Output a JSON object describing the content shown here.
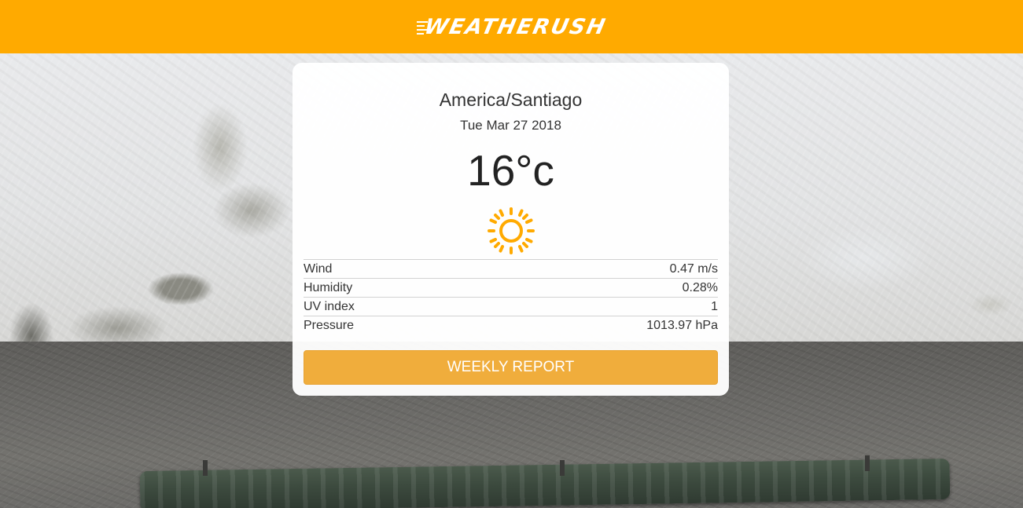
{
  "header": {
    "logo_text": "WEATHERUSH",
    "background_color": "#ffaa00"
  },
  "weather": {
    "city": "America/Santiago",
    "date": "Tue Mar 27 2018",
    "temperature": "16°c",
    "condition_icon": "sun-icon",
    "icon_color": "#ffaa00"
  },
  "stats": [
    {
      "label": "Wind",
      "value": "0.47 m/s"
    },
    {
      "label": "Humidity",
      "value": "0.28%"
    },
    {
      "label": "UV index",
      "value": "1"
    },
    {
      "label": "Pressure",
      "value": "1013.97 hPa"
    }
  ],
  "actions": {
    "weekly_report_label": "WEEKLY REPORT",
    "button_color": "#f0ad3c"
  }
}
